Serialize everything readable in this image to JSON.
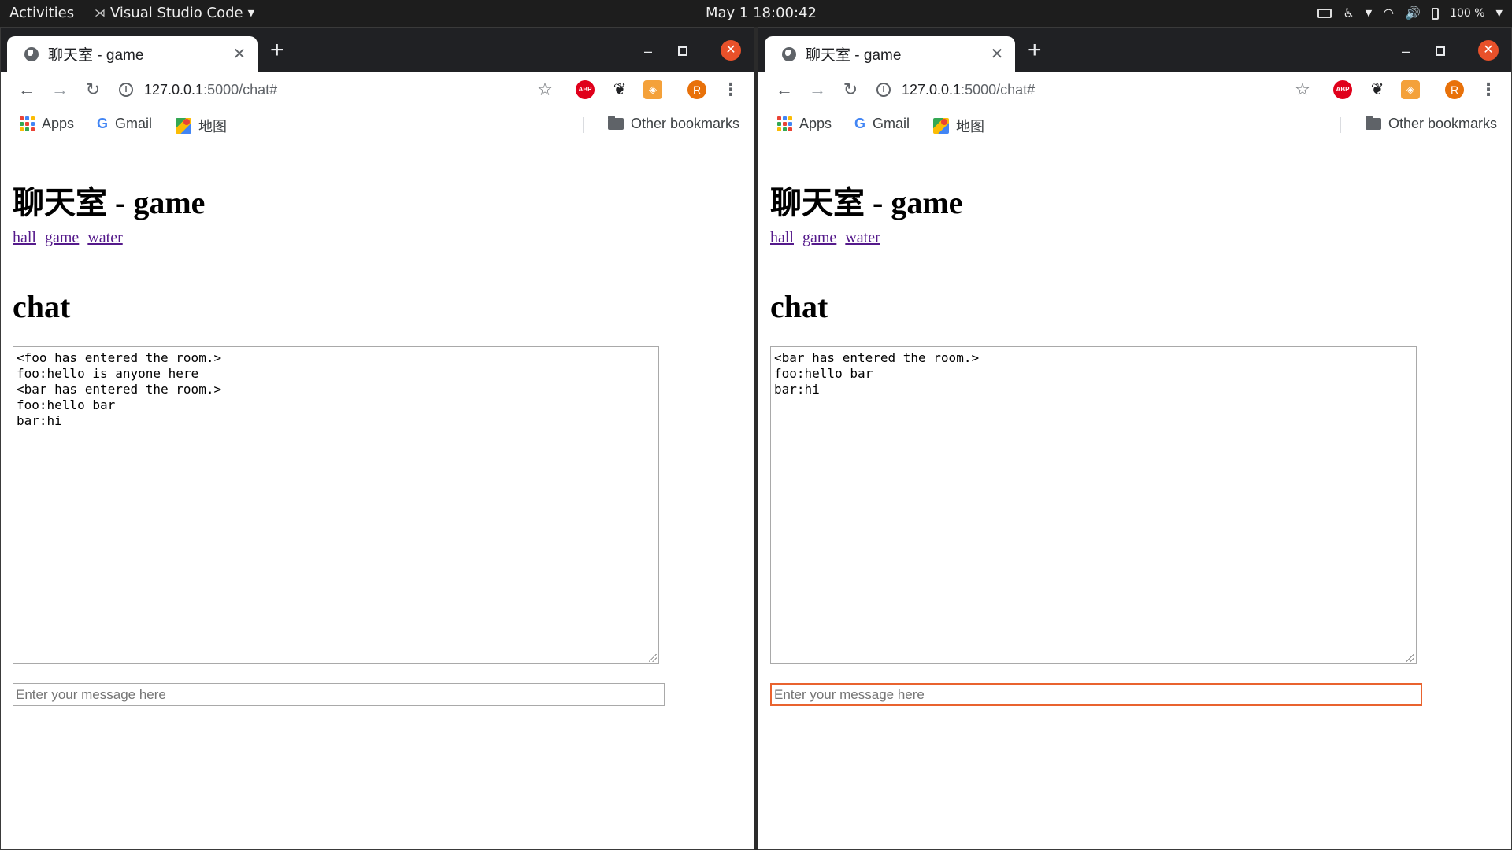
{
  "topbar": {
    "activities": "Activities",
    "app_name": "Visual Studio Code",
    "clock": "May 1  18:00:42",
    "battery": "100 %"
  },
  "windows": [
    {
      "tab_title": "聊天室 - game",
      "url_host": "127.0.0.1",
      "url_path": ":5000/chat#",
      "avatar_letter": "R",
      "bookmarks": {
        "apps": "Apps",
        "gmail": "Gmail",
        "maps": "地图",
        "other": "Other bookmarks"
      },
      "page": {
        "title": "聊天室 - game",
        "nav": [
          "hall",
          "game",
          "water"
        ],
        "subtitle": "chat",
        "chat_log": "<foo has entered the room.>\nfoo:hello is anyone here\n<bar has entered the room.>\nfoo:hello bar\nbar:hi",
        "input_placeholder": "Enter your message here"
      }
    },
    {
      "tab_title": "聊天室 - game",
      "url_host": "127.0.0.1",
      "url_path": ":5000/chat#",
      "avatar_letter": "R",
      "bookmarks": {
        "apps": "Apps",
        "gmail": "Gmail",
        "maps": "地图",
        "other": "Other bookmarks"
      },
      "page": {
        "title": "聊天室 - game",
        "nav": [
          "hall",
          "game",
          "water"
        ],
        "subtitle": "chat",
        "chat_log": "<bar has entered the room.>\nfoo:hello bar\nbar:hi",
        "input_placeholder": "Enter your message here"
      }
    }
  ],
  "icons": {
    "back": "arrow-left-icon",
    "forward": "arrow-right-icon",
    "reload": "reload-icon",
    "info": "site-info-icon",
    "star": "bookmark-star-icon",
    "menu": "kebab-menu-icon"
  },
  "colors": {
    "focus_border": "#e9632f",
    "link_visited": "#551a8b",
    "close_button": "#e8512a"
  }
}
